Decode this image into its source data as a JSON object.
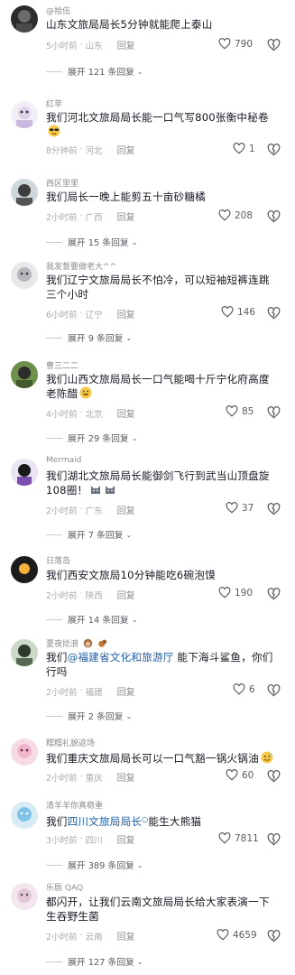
{
  "comments": [
    {
      "name": "@拾伍",
      "text": "山东文旅局局长5分钟就能爬上泰山",
      "time": "5小时前",
      "location": "山东",
      "reply": "回复",
      "likes": "790",
      "expand": "展开 121 条回复"
    },
    {
      "name": "红苹",
      "text": "我们河北文旅局局长能一口气写800张衡中秘卷",
      "time": "8分钟前",
      "location": "河北",
      "reply": "回复",
      "likes": "1",
      "expand": ""
    },
    {
      "name": "西区里里",
      "text": "我们局长一晚上能剪五十亩砂糖橘",
      "time": "2小时前",
      "location": "广西",
      "reply": "回复",
      "likes": "208",
      "expand": "展开 15 条回复"
    },
    {
      "name": "我发誓要做老大^^",
      "text": "我们辽宁文旅局局长不怕冷，可以短袖短裤连跳三个小时",
      "time": "6小时前",
      "location": "辽宁",
      "reply": "回复",
      "likes": "146",
      "expand": "展开 9 条回复"
    },
    {
      "name": "曹三二二",
      "text": "我们山西文旅局局长一口气能喝十斤宁化府高度老陈醋",
      "time": "4小时前",
      "location": "北京",
      "reply": "回复",
      "likes": "85",
      "expand": "展开 29 条回复"
    },
    {
      "name": "Mermaid",
      "text": "我们湖北文旅局局长能御剑飞行到武当山顶盘旋108圈！",
      "time": "2小时前",
      "location": "广东",
      "reply": "回复",
      "likes": "37",
      "expand": "展开 7 条回复"
    },
    {
      "name": "日落岛",
      "text": "我们西安文旅局10分钟能吃6碗泡馍",
      "time": "2小时前",
      "location": "陕西",
      "reply": "回复",
      "likes": "190",
      "expand": "展开 14 条回复"
    },
    {
      "name": "夏夜捻浪",
      "text_prefix": "我们",
      "text_mention": "@福建省文化和旅游厅",
      "text_suffix": " 能下海斗鲨鱼，你们行吗",
      "time": "2小时前",
      "location": "福建",
      "reply": "回复",
      "likes": "6",
      "expand": "展开 2 条回复"
    },
    {
      "name": "糯糯礼貌返场",
      "text": "我们重庆文旅局局长可以一口气豁一锅火锅油",
      "time": "2小时前",
      "location": "重庆",
      "reply": "回复",
      "likes": "60",
      "expand": ""
    },
    {
      "name": "清羊羊你真稳重",
      "text_prefix": "我们",
      "text_mention": "四川文旅局局长",
      "text_suffix": "能生大熊猫",
      "time": "3小时前",
      "location": "四川",
      "reply": "回复",
      "likes": "7811",
      "expand": "展开 389 条回复"
    },
    {
      "name": "乐唇 QAQ",
      "text": "都闪开，让我们云南文旅局局长给大家表演一下生吞野生菌",
      "time": "2小时前",
      "location": "云南",
      "reply": "回复",
      "likes": "4659",
      "expand": "展开 127 条回复"
    }
  ],
  "colors": {
    "primary_text": "#161823",
    "secondary_text": "#8a8b91",
    "mention": "#1f5fa8"
  },
  "icons": [
    "heart-outline-icon",
    "broken-heart-icon",
    "chevron-down-icon"
  ]
}
